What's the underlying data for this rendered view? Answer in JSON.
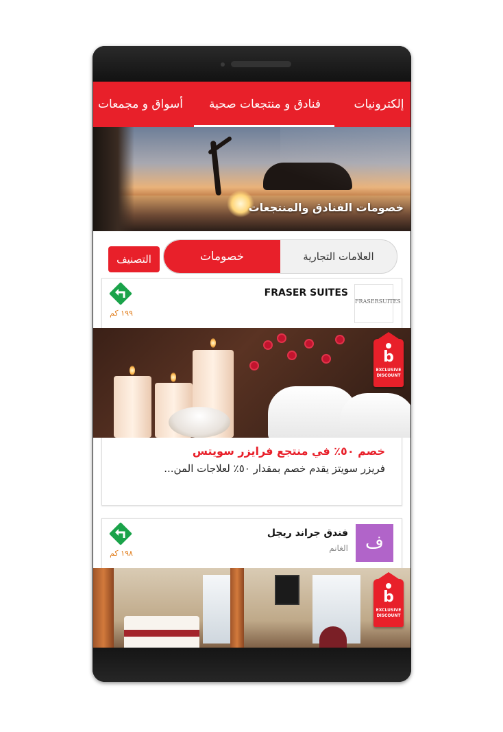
{
  "tabs": [
    {
      "label": "إلكترونيات"
    },
    {
      "label": "فنادق و منتجعات صحية"
    },
    {
      "label": "أسواق و مجمعات"
    }
  ],
  "hero": {
    "caption": "خصومات الفنادق والمنتجعات"
  },
  "segment": {
    "brands_label": "العلامات التجارية",
    "discounts_label": "خصومات"
  },
  "sort_label": "التصنيف",
  "offers": [
    {
      "brand": "FRASER SUITES",
      "logo_text": "FRASERSUITES",
      "distance": "١٩٩ كم",
      "badge_text": "EXCLUSIVE DISCOUNT",
      "title": "خصم ٥٠٪ في منتجع فرايزر سويتس",
      "description": "فريزر سويتز يقدم خصم بمقدار ٥٠٪ لعلاجات المن..."
    },
    {
      "brand": "فندق جراند ريجل",
      "logo_letter": "ف",
      "location": "الغانم",
      "distance": "١٩٨ كم",
      "badge_text": "EXCLUSIVE DISCOUNT"
    }
  ],
  "colors": {
    "accent": "#e8202a",
    "distance": "#e07b18",
    "direction_icon": "#1aa34a",
    "logo_purple": "#b164c9"
  },
  "icons": {
    "direction": "turn-left-arrow-icon",
    "badge": "exclusive-discount-tag-icon"
  }
}
